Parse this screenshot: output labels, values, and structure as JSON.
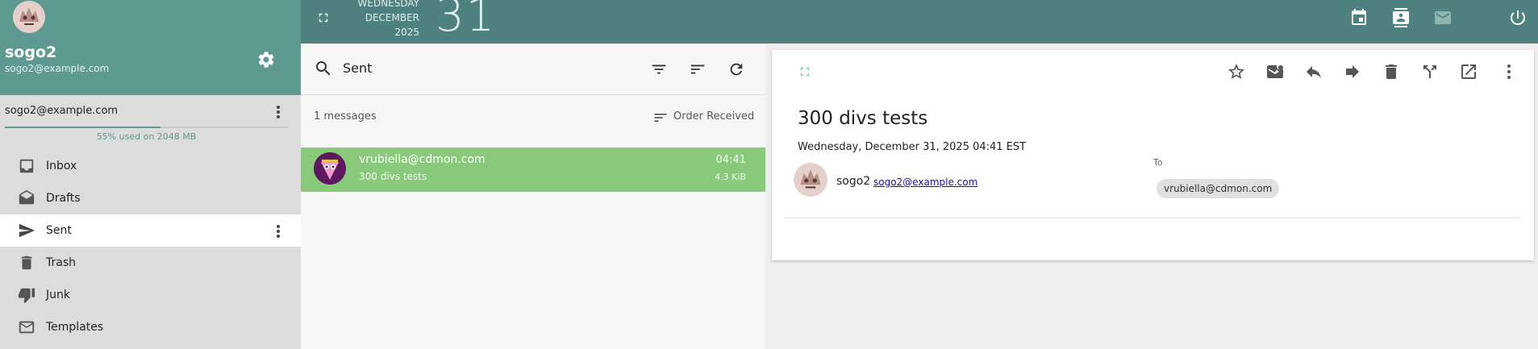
{
  "colors": {
    "sidebar_header": "#5e9a91",
    "topbar": "#4f8180",
    "selected_message": "#88c97b",
    "quota_fill": "#5e9a91"
  },
  "sidebar": {
    "user_name": "sogo2",
    "user_email": "sogo2@example.com",
    "account_email": "sogo2@example.com",
    "quota_fraction": 0.55,
    "quota_text": "55% used on 2048 MB",
    "folders": [
      {
        "label": "Inbox",
        "icon": "inbox-icon"
      },
      {
        "label": "Drafts",
        "icon": "drafts-icon"
      },
      {
        "label": "Sent",
        "icon": "send-icon",
        "active": true
      },
      {
        "label": "Trash",
        "icon": "trash-icon"
      },
      {
        "label": "Junk",
        "icon": "junk-icon"
      },
      {
        "label": "Templates",
        "icon": "templates-icon"
      }
    ]
  },
  "topbar": {
    "weekday": "WEDNESDAY",
    "month": "DECEMBER",
    "year": "2025",
    "day": "31"
  },
  "list": {
    "folder_title": "Sent",
    "count_text": "1 messages",
    "order_label": "Order Received",
    "messages": [
      {
        "from": "vrubiella@cdmon.com",
        "subject": "300 divs tests",
        "time": "04:41",
        "size": "4.3 KiB"
      }
    ]
  },
  "viewer": {
    "subject": "300 divs tests",
    "date": "Wednesday, December 31, 2025 04:41 EST",
    "from_name": "sogo2",
    "from_email": "sogo2@example.com",
    "to_label": "To",
    "to_recipient": "vrubiella@cdmon.com"
  }
}
